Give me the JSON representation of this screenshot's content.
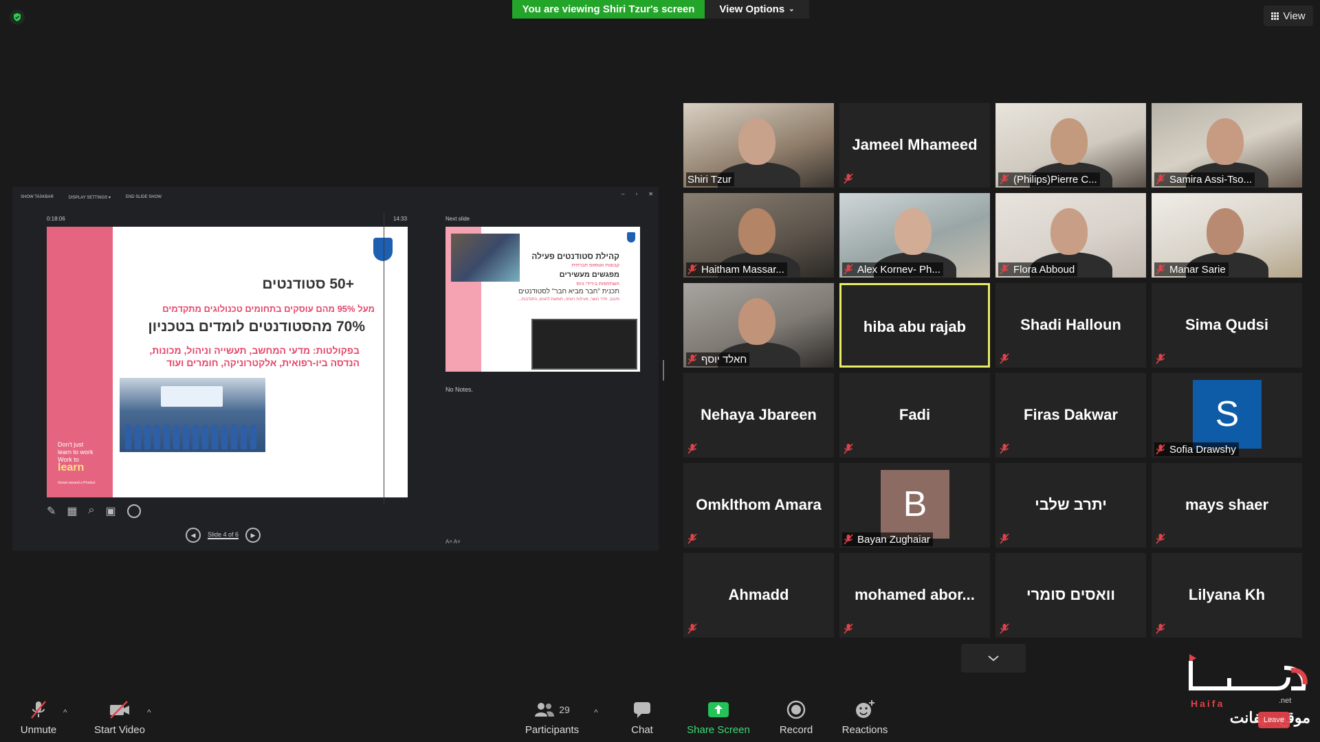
{
  "topbar": {
    "share_banner": "You are viewing Shiri Tzur's screen",
    "view_options": "View Options",
    "view_label": "View"
  },
  "presentation": {
    "toolbar": [
      "SHOW TASKBAR",
      "DISPLAY SETTINGS ▾",
      "END SLIDE SHOW"
    ],
    "timer": "0:18:06",
    "clock": "14:33",
    "slide": {
      "headline": "+50 סטודנטים",
      "line1": "מעל 95% מהם עוסקים בתחומים טכנולוגים מתקדמים",
      "line2": "70% מהסטודנטים לומדים בטכניון",
      "line3": "בפקולטות: מדעי המחשב, תעשייה וניהול, מכונות,",
      "line4": "הנדסה ביו-רפואית, אלקטרוניקה, חומרים ועוד",
      "left_text1": "Don't just",
      "left_text2": "learn to work",
      "left_text3": "Work to",
      "left_learn": "learn",
      "left_small": "Grown around a Product"
    },
    "next_slide_label": "Next slide",
    "next_slide": {
      "title": "קהילת סטודנטים פעילה",
      "l1": "קבוצות ווטסאפ חברתית",
      "l2": "מפגשים מעשירים",
      "l3": "השתתפות בירידי גיוס",
      "l4": "תכנית \"חבר מביא חבר\" לסטודנטים",
      "l5": "סיבוב, חדר כושר, פעילות רווחה, חופשת לחגים, התנדבות..."
    },
    "notes": "No Notes.",
    "slide_indicator": "Slide 4 of 6",
    "font_controls": "A˄  A˅"
  },
  "gallery": {
    "tiles": [
      {
        "name": "Shiri Tzur",
        "type": "video",
        "muted": false
      },
      {
        "name": "Jameel Mhameed",
        "type": "name",
        "muted": true
      },
      {
        "name": "(Philips)Pierre C...",
        "type": "video",
        "muted": true
      },
      {
        "name": "Samira Assi-Tso...",
        "type": "video",
        "muted": true
      },
      {
        "name": "Haitham Massar...",
        "type": "video",
        "muted": true
      },
      {
        "name": "Alex Kornev- Ph...",
        "type": "video",
        "muted": true
      },
      {
        "name": "Flora Abboud",
        "type": "video",
        "muted": true
      },
      {
        "name": "Manar Sarie",
        "type": "video",
        "muted": true
      },
      {
        "name": "חאלד יוסף",
        "type": "video",
        "muted": true
      },
      {
        "name": "hiba abu rajab",
        "type": "name",
        "muted": false,
        "active": true
      },
      {
        "name": "Shadi Halloun",
        "type": "name",
        "muted": true
      },
      {
        "name": "Sima Qudsi",
        "type": "name",
        "muted": true
      },
      {
        "name": "Nehaya Jbareen",
        "type": "name",
        "muted": true
      },
      {
        "name": "Fadi",
        "type": "name",
        "muted": true
      },
      {
        "name": "Firas Dakwar",
        "type": "name",
        "muted": true
      },
      {
        "name": "Sofia Drawshy",
        "type": "avatar",
        "initial": "S",
        "color": "#0e5ba8",
        "muted": true
      },
      {
        "name": "Omklthom Amara",
        "type": "name",
        "muted": true
      },
      {
        "name": "Bayan Zughaiar",
        "type": "avatar",
        "initial": "B",
        "color": "#8c6b62",
        "muted": true
      },
      {
        "name": "יתרב שלבי",
        "type": "name",
        "muted": true
      },
      {
        "name": "mays shaer",
        "type": "name",
        "muted": true
      },
      {
        "name": "Ahmadd",
        "type": "name",
        "muted": true
      },
      {
        "name": "mohamed  abor...",
        "type": "name",
        "muted": true
      },
      {
        "name": "וואסים סומרי",
        "type": "name",
        "muted": true
      },
      {
        "name": "Lilyana Kh",
        "type": "name",
        "muted": true
      }
    ]
  },
  "toolbar": {
    "unmute": "Unmute",
    "start_video": "Start Video",
    "participants": "Participants",
    "participants_count": "29",
    "chat": "Chat",
    "share_screen": "Share Screen",
    "record": "Record",
    "reactions": "Reactions"
  },
  "watermark": {
    "brand": "Haifa",
    "suffix": ".net",
    "arabic": "موقع حيفانت",
    "leave": "Leave"
  },
  "colors": {
    "share_green": "#23a52a",
    "active_speaker": "#e8ec63",
    "muted_red": "#e0424a",
    "slide_pink": "#e5647f"
  }
}
